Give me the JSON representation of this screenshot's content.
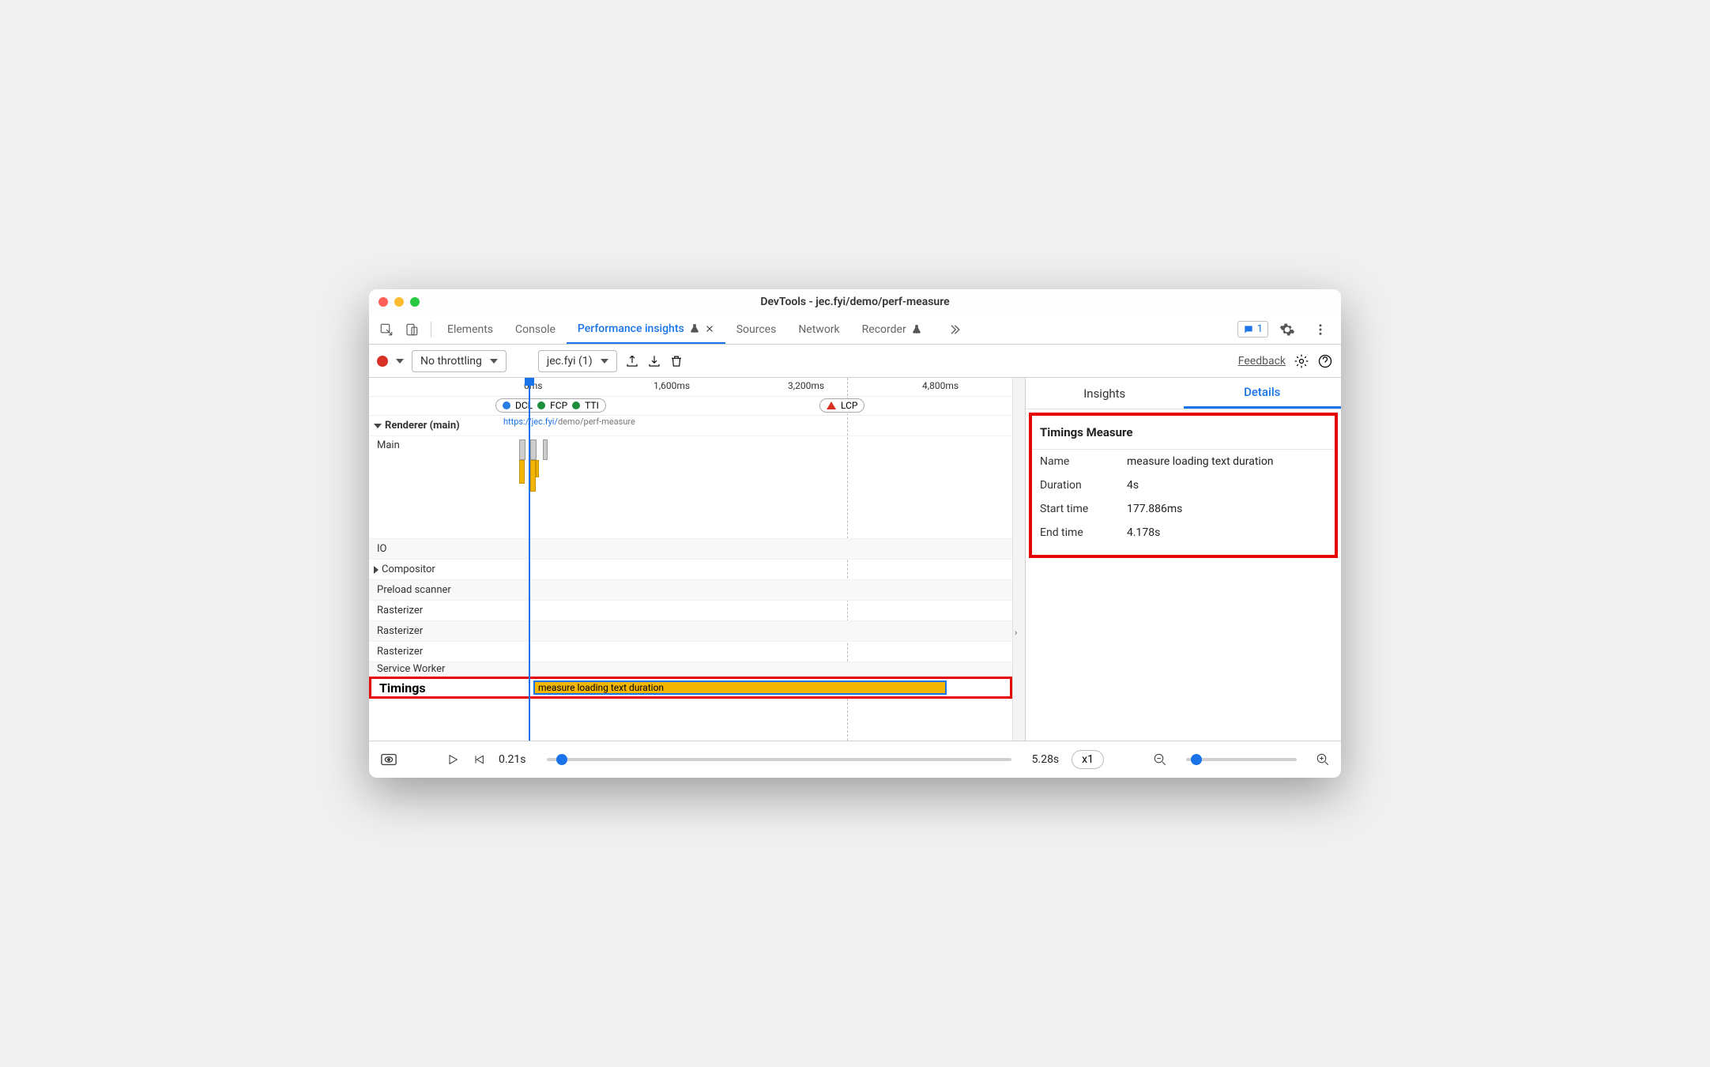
{
  "window": {
    "title": "DevTools - jec.fyi/demo/perf-measure"
  },
  "tabs": {
    "elements": "Elements",
    "console": "Console",
    "perf_insights": "Performance insights",
    "sources": "Sources",
    "network": "Network",
    "recorder": "Recorder"
  },
  "issues_count": "1",
  "toolbar": {
    "throttle": "No throttling",
    "recording": "jec.fyi (1)",
    "feedback": "Feedback"
  },
  "ruler": {
    "t0": "0ms",
    "t1": "1,600ms",
    "t2": "3,200ms",
    "t3": "4,800ms"
  },
  "markers": {
    "dcl": "DCL",
    "fcp": "FCP",
    "tti": "TTI",
    "lcp": "LCP"
  },
  "url_fragment_blue": "https://jec.fyi/",
  "url_fragment_grey": "demo/perf-measure",
  "tracks": {
    "renderer": "Renderer (main)",
    "main": "Main",
    "io": "IO",
    "compositor": "Compositor",
    "preload": "Preload scanner",
    "rasterizer": "Rasterizer",
    "service_worker": "Service Worker",
    "timings": "Timings"
  },
  "timing_bar_label": "measure loading text duration",
  "side": {
    "insights": "Insights",
    "details": "Details",
    "panel_title": "Timings Measure",
    "rows": {
      "name_k": "Name",
      "name_v": "measure loading text duration",
      "dur_k": "Duration",
      "dur_v": "4s",
      "start_k": "Start time",
      "start_v": "177.886ms",
      "end_k": "End time",
      "end_v": "4.178s"
    }
  },
  "footer": {
    "start": "0.21s",
    "end": "5.28s",
    "speed": "x1"
  }
}
